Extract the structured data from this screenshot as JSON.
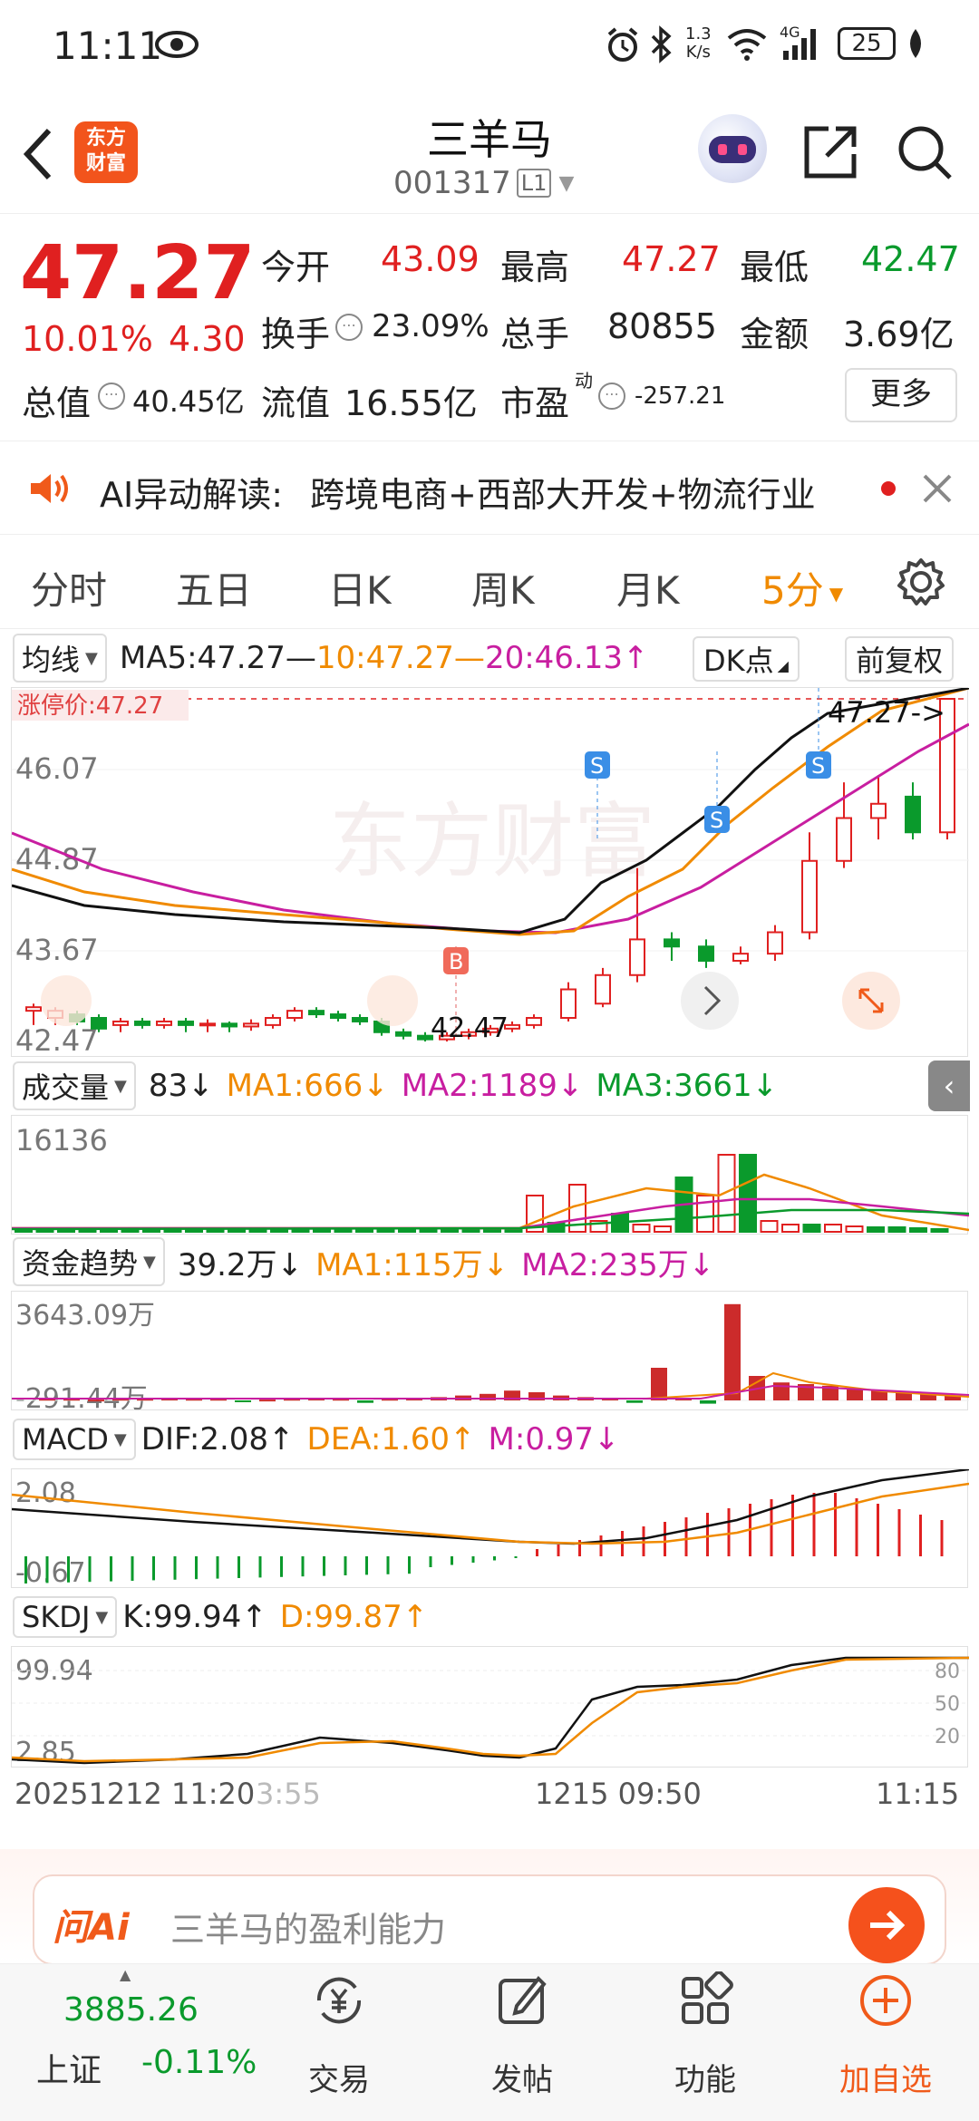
{
  "status_bar": {
    "time": "11:11",
    "net_speed_top": "1.3",
    "net_speed_bottom": "K/s",
    "signal": "4G",
    "battery": "25"
  },
  "header": {
    "title": "三羊马",
    "code": "001317",
    "level": "L1",
    "brand_top": "东方",
    "brand_bottom": "财富"
  },
  "quote": {
    "price": "47.27",
    "pct": "10.01%",
    "change": "4.30",
    "open_label": "今开",
    "open": "43.09",
    "high_label": "最高",
    "high": "47.27",
    "low_label": "最低",
    "low": "42.47",
    "turnover_label": "换手",
    "turnover": "23.09%",
    "volume_label": "总手",
    "volume": "80855",
    "amount_label": "金额",
    "amount": "3.69亿",
    "mktcap_label": "总值",
    "mktcap": "40.45亿",
    "float_label": "流值",
    "float_cap": "16.55亿",
    "pe_label": "市盈",
    "pe_sup": "动",
    "pe": "-257.21",
    "more": "更多"
  },
  "ai_banner": {
    "label": "AI异动解读:",
    "text": "跨境电商+西部大开发+物流行业"
  },
  "tabs": {
    "fenshi": "分时",
    "wuri": "五日",
    "rik": "日K",
    "zhouk": "周K",
    "yuek": "月K",
    "min5": "5分"
  },
  "ma_bar": {
    "selector": "均线",
    "ma5": "MA5:47.27—",
    "ma10": "10:47.27—",
    "ma20": "20:46.13↑",
    "dk": "DK点",
    "fq": "前复权"
  },
  "kline": {
    "limit_label": "涨停价:47.27",
    "y_labels": [
      "46.07",
      "44.87",
      "43.67",
      "42.47"
    ],
    "current_tag": "47.27->",
    "low_tag": "42.47",
    "buy_marker": "B",
    "sell_marker": "S",
    "watermark": "东方财富"
  },
  "volume_panel": {
    "selector": "成交量",
    "value": "83↓",
    "ma1": "MA1:666↓",
    "ma2": "MA2:1189↓",
    "ma3": "MA3:3661↓",
    "top_label": "16136"
  },
  "capital_panel": {
    "selector": "资金趋势",
    "value": "39.2万↓",
    "ma1": "MA1:115万↓",
    "ma2": "MA2:235万↓",
    "top_label": "3643.09万",
    "bottom_label": "-291.44万"
  },
  "macd_panel": {
    "selector": "MACD",
    "dif": "DIF:2.08↑",
    "dea": "DEA:1.60↑",
    "m": "M:0.97↓",
    "top_label": "2.08",
    "bottom_label": "-0.67"
  },
  "skdj_panel": {
    "selector": "SKDJ",
    "k": "K:99.94↑",
    "d": "D:99.87↑",
    "top_label": "99.94",
    "bottom_label": "2.85",
    "levels": [
      "80",
      "50",
      "20"
    ]
  },
  "time_axis": {
    "left": "20251212 11:20",
    "left_faded": "3:55",
    "mid": "1215 09:50",
    "right": "11:15"
  },
  "ask_ai": {
    "brand": "问Ai",
    "placeholder": "三羊马的盈利能力"
  },
  "bottom_nav": {
    "index_value": "3885.26",
    "index_name": "上证",
    "index_pct": "-0.11%",
    "trade": "交易",
    "post": "发帖",
    "func": "功能",
    "add": "加自选"
  },
  "colors": {
    "up": "#e02020",
    "down": "#0a9a2c",
    "accent": "#f08a00",
    "ma_magenta": "#c81ea0"
  }
}
